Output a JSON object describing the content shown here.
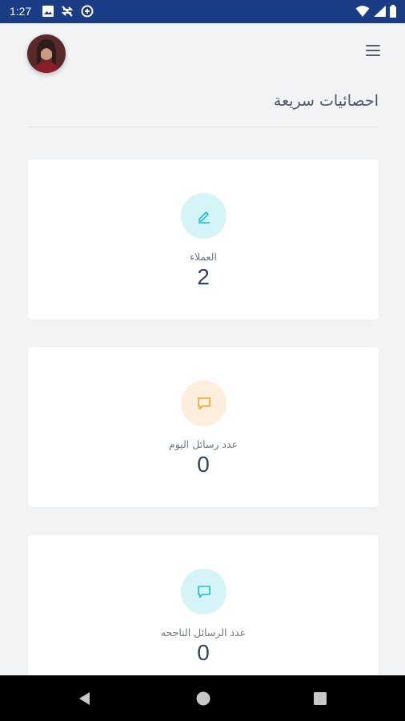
{
  "status_bar": {
    "time": "1:27",
    "icons_left": [
      "image-icon",
      "no-sync-icon",
      "data-saver-icon"
    ],
    "icons_right": [
      "wifi-icon",
      "signal-icon",
      "battery-icon"
    ],
    "background": "#1a3c84"
  },
  "header": {
    "title": "احصائيات سريعة",
    "avatar": "user-avatar",
    "menu_icon": "hamburger-menu-icon"
  },
  "cards": [
    {
      "label": "العملاء",
      "value": "2",
      "icon": "edit-icon",
      "icon_bg": "#d4f4f7",
      "icon_color": "#17c0d3"
    },
    {
      "label": "عدد رسائل اليوم",
      "value": "0",
      "icon": "message-icon",
      "icon_bg": "#fdeedd",
      "icon_color": "#f5a623"
    },
    {
      "label": "عدد الرسائل الناجحه",
      "value": "0",
      "icon": "message-icon",
      "icon_bg": "#d4f4f7",
      "icon_color": "#17c0d3"
    }
  ],
  "nav_bar": {
    "buttons": [
      "back-icon",
      "home-icon",
      "recents-icon"
    ]
  }
}
